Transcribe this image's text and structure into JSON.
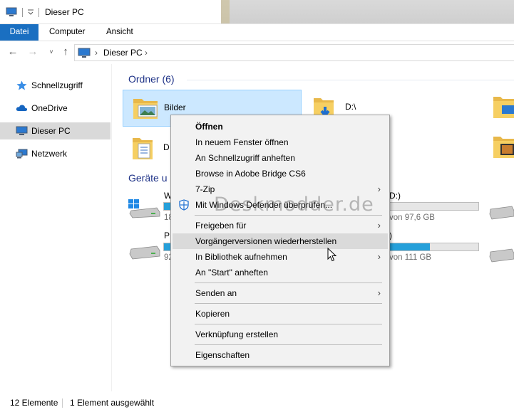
{
  "window": {
    "title": "Dieser PC"
  },
  "ribbon": {
    "tabs": [
      "Datei",
      "Computer",
      "Ansicht"
    ]
  },
  "address": {
    "path": "Dieser PC"
  },
  "sidebar": {
    "items": [
      {
        "label": "Schnellzugriff",
        "icon": "star-icon"
      },
      {
        "label": "OneDrive",
        "icon": "cloud-icon"
      },
      {
        "label": "Dieser PC",
        "icon": "computer-icon",
        "selected": true
      },
      {
        "label": "Netzwerk",
        "icon": "network-icon"
      }
    ]
  },
  "main": {
    "folders_header": "Ordner (6)",
    "devices_header": "Geräte u",
    "folders": [
      {
        "label": "Bilder",
        "icon": "pictures-folder-icon",
        "selected": true
      },
      {
        "label": "D:\\",
        "icon": "downloads-folder-icon"
      },
      {
        "label": "D",
        "icon": "documents-folder-icon"
      }
    ],
    "devices": [
      {
        "name_fragment": "W",
        "size_fragment": "18",
        "drive_letter": "D:)",
        "free": "von 97,6 GB",
        "usage_primary": 0.3,
        "usage_secondary": 0.0
      },
      {
        "name_fragment": "P",
        "size_fragment": "92",
        "drive_letter": ")",
        "free": "von 111 GB",
        "usage_primary": 0.3,
        "usage_secondary": 0.45
      }
    ]
  },
  "watermark": "Deskmodder.de",
  "context_menu": {
    "items": [
      {
        "label": "Öffnen",
        "bold": true
      },
      {
        "label": "In neuem Fenster öffnen"
      },
      {
        "label": "An Schnellzugriff anheften"
      },
      {
        "label": "Browse in Adobe Bridge CS6"
      },
      {
        "label": "7-Zip",
        "submenu": true
      },
      {
        "label": "Mit Windows Defender überprüfen...",
        "icon": "defender-icon"
      },
      {
        "label": "Freigeben für",
        "submenu": true
      },
      {
        "label": "Vorgängerversionen wiederherstellen",
        "hover": true
      },
      {
        "label": "In Bibliothek aufnehmen",
        "submenu": true
      },
      {
        "label": "An \"Start\" anheften"
      },
      {
        "label": "Senden an",
        "submenu": true
      },
      {
        "label": "Kopieren"
      },
      {
        "label": "Verknüpfung erstellen"
      },
      {
        "label": "Eigenschaften"
      }
    ]
  },
  "status": {
    "count": "12 Elemente",
    "selection": "1 Element ausgewählt"
  },
  "colors": {
    "accent": "#1a6fc1",
    "selection": "#cce8ff",
    "header": "#1e3287",
    "bar": "#26a0da"
  }
}
